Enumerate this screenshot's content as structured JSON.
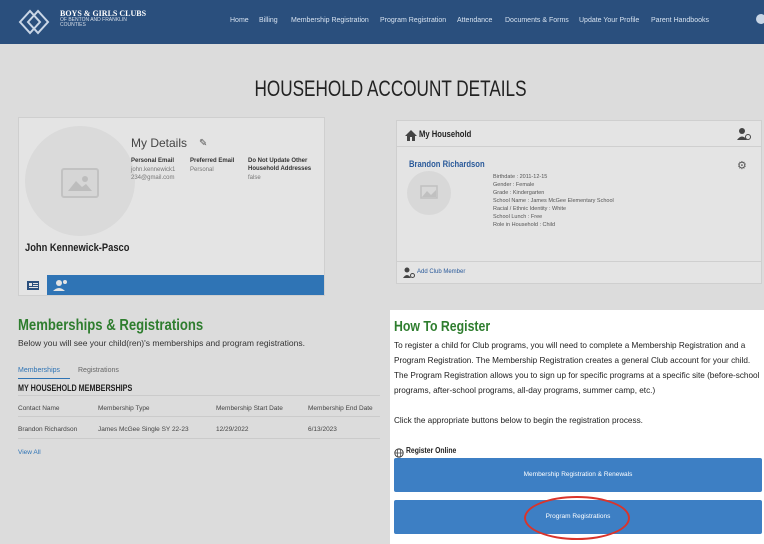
{
  "nav": {
    "brand_line1": "BOYS & GIRLS CLUBS",
    "brand_line2": "OF BENTON AND FRANKLIN",
    "brand_line3": "COUNTIES",
    "links": [
      "Home",
      "Billing",
      "Membership Registration",
      "Program Registration",
      "Attendance",
      "Documents & Forms",
      "Update Your Profile",
      "Parent Handbooks"
    ]
  },
  "page_title": "HOUSEHOLD ACCOUNT DETAILS",
  "my_details": {
    "title": "My Details",
    "personal_email_label": "Personal Email",
    "personal_email_value_1": "john.kennewick1",
    "personal_email_value_2": "234@gmail.com",
    "preferred_email_label": "Preferred Email",
    "preferred_email_value": "Personal",
    "do_not_update_label_1": "Do Not Update Other",
    "do_not_update_label_2": "Household Addresses",
    "do_not_update_value": "false",
    "name": "John Kennewick-Pasco"
  },
  "household": {
    "title": "My Household",
    "member_name": "Brandon Richardson",
    "member_details": [
      "Birthdate : 2011-12-15",
      "Gender : Female",
      "Grade : Kindergarten",
      "School Name : James McGee Elementary School",
      "Racial / Ethnic Identity : White",
      "School Lunch : Free",
      "Role in Household : Child"
    ],
    "add_member": "Add Club Member"
  },
  "memberships": {
    "title": "Memberships & Registrations",
    "subtitle": "Below you will see your child(ren)'s memberships and program registrations.",
    "tab_memberships": "Memberships",
    "tab_registrations": "Registrations",
    "section_title": "MY HOUSEHOLD MEMBERSHIPS",
    "columns": [
      "Contact Name",
      "Membership Type",
      "Membership Start Date",
      "Membership End Date"
    ],
    "rows": [
      [
        "Brandon Richardson",
        "James McGee Single SY 22-23",
        "12/29/2022",
        "6/13/2023"
      ]
    ],
    "view_all": "View All"
  },
  "how_to_register": {
    "title": "How To Register",
    "paragraph": "To register a child for Club programs, you will need to complete a Membership Registration and a Program Registration. The Membership Registration creates a general Club account for your child. The Program Registration allows you to sign up for specific programs at a specific site (before-school programs, after-school programs, all-day programs, summer camp, etc.)",
    "paragraph2": "Click the appropriate buttons below to begin the registration process.",
    "register_online": "Register Online",
    "button_membership": "Membership Registration & Renewals",
    "button_program": "Program Registrations"
  },
  "colors": {
    "nav_bg": "#2a4f7d",
    "accent_blue": "#2f74b5",
    "green_heading": "#2e7d2e",
    "highlight_circle": "#d9342b"
  }
}
